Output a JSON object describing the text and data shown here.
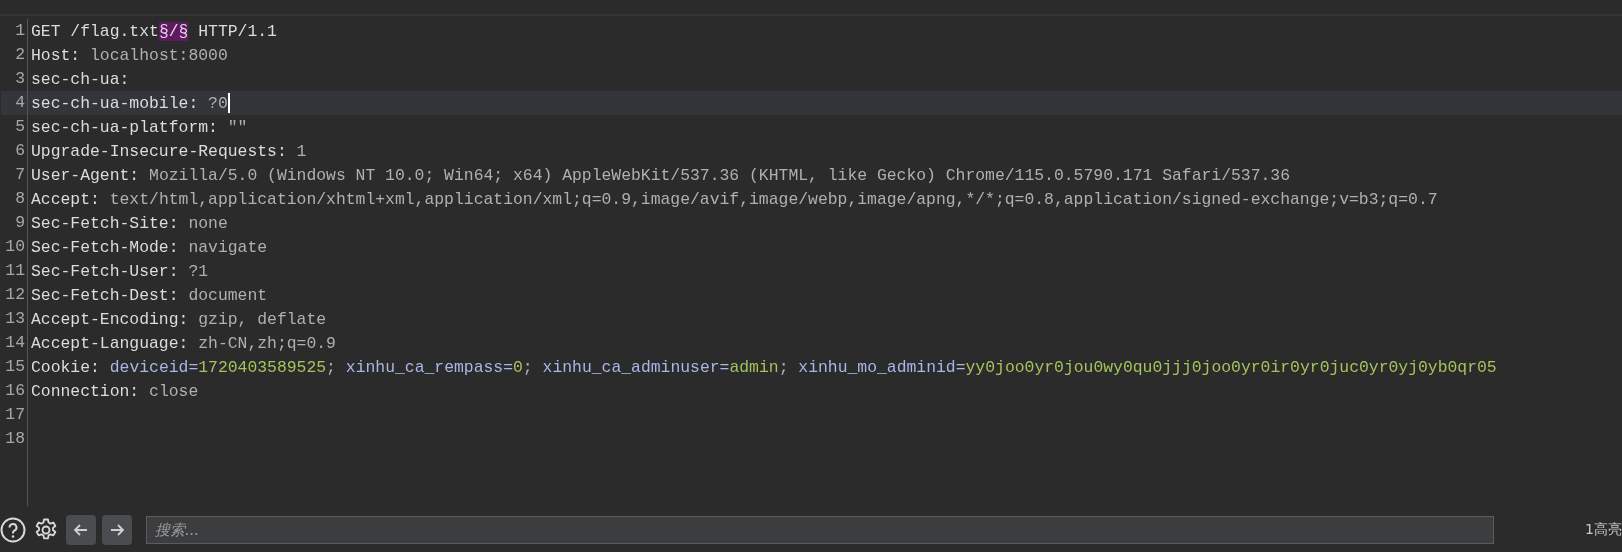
{
  "editor": {
    "lines": [
      {
        "number": "1",
        "current": false,
        "segments": [
          {
            "kind": "key",
            "text": "GET /flag.txt"
          },
          {
            "kind": "marker",
            "text": "§/§"
          },
          {
            "kind": "key",
            "text": " HTTP/1.1"
          }
        ]
      },
      {
        "number": "2",
        "current": false,
        "segments": [
          {
            "kind": "key",
            "text": "Host:"
          },
          {
            "kind": "text",
            "text": " localhost:8000"
          }
        ]
      },
      {
        "number": "3",
        "current": false,
        "segments": [
          {
            "kind": "key",
            "text": "sec-ch-ua:"
          }
        ]
      },
      {
        "number": "4",
        "current": true,
        "segments": [
          {
            "kind": "key",
            "text": "sec-ch-ua-mobile:"
          },
          {
            "kind": "text",
            "text": " ?0"
          }
        ]
      },
      {
        "number": "5",
        "current": false,
        "segments": [
          {
            "kind": "key",
            "text": "sec-ch-ua-platform:"
          },
          {
            "kind": "text",
            "text": " \"\""
          }
        ]
      },
      {
        "number": "6",
        "current": false,
        "segments": [
          {
            "kind": "key",
            "text": "Upgrade-Insecure-Requests:"
          },
          {
            "kind": "text",
            "text": " 1"
          }
        ]
      },
      {
        "number": "7",
        "current": false,
        "segments": [
          {
            "kind": "key",
            "text": "User-Agent:"
          },
          {
            "kind": "text",
            "text": " Mozilla/5.0 (Windows NT 10.0; Win64; x64) AppleWebKit/537.36 (KHTML, like Gecko) Chrome/115.0.5790.171 Safari/537.36"
          }
        ]
      },
      {
        "number": "8",
        "current": false,
        "segments": [
          {
            "kind": "key",
            "text": "Accept:"
          },
          {
            "kind": "text",
            "text": " text/html,application/xhtml+xml,application/xml;q=0.9,image/avif,image/webp,image/apng,*/*;q=0.8,application/signed-exchange;v=b3;q=0.7"
          }
        ]
      },
      {
        "number": "9",
        "current": false,
        "segments": [
          {
            "kind": "key",
            "text": "Sec-Fetch-Site:"
          },
          {
            "kind": "text",
            "text": " none"
          }
        ]
      },
      {
        "number": "10",
        "current": false,
        "segments": [
          {
            "kind": "key",
            "text": "Sec-Fetch-Mode:"
          },
          {
            "kind": "text",
            "text": " navigate"
          }
        ]
      },
      {
        "number": "11",
        "current": false,
        "segments": [
          {
            "kind": "key",
            "text": "Sec-Fetch-User:"
          },
          {
            "kind": "text",
            "text": " ?1"
          }
        ]
      },
      {
        "number": "12",
        "current": false,
        "segments": [
          {
            "kind": "key",
            "text": "Sec-Fetch-Dest:"
          },
          {
            "kind": "text",
            "text": " document"
          }
        ]
      },
      {
        "number": "13",
        "current": false,
        "segments": [
          {
            "kind": "key",
            "text": "Accept-Encoding:"
          },
          {
            "kind": "text",
            "text": " gzip, deflate"
          }
        ]
      },
      {
        "number": "14",
        "current": false,
        "segments": [
          {
            "kind": "key",
            "text": "Accept-Language:"
          },
          {
            "kind": "text",
            "text": " zh-CN,zh;q=0.9"
          }
        ]
      },
      {
        "number": "15",
        "current": false,
        "segments": [
          {
            "kind": "key",
            "text": "Cookie: "
          },
          {
            "kind": "param",
            "text": "deviceid="
          },
          {
            "kind": "value",
            "text": "1720403589525"
          },
          {
            "kind": "text",
            "text": "; "
          },
          {
            "kind": "param",
            "text": "xinhu_ca_rempass="
          },
          {
            "kind": "value",
            "text": "0"
          },
          {
            "kind": "text",
            "text": "; "
          },
          {
            "kind": "param",
            "text": "xinhu_ca_adminuser="
          },
          {
            "kind": "value",
            "text": "admin"
          },
          {
            "kind": "text",
            "text": "; "
          },
          {
            "kind": "param",
            "text": "xinhu_mo_adminid="
          },
          {
            "kind": "value",
            "text": "yy0joo0yr0jou0wy0qu0jjj0joo0yr0ir0yr0juc0yr0yj0yb0qr05"
          }
        ]
      },
      {
        "number": "16",
        "current": false,
        "segments": [
          {
            "kind": "key",
            "text": "Connection:"
          },
          {
            "kind": "text",
            "text": " close"
          }
        ]
      },
      {
        "number": "17",
        "current": false
      },
      {
        "number": "18",
        "current": false
      }
    ]
  },
  "search_bar": {
    "placeholder": "搜索...",
    "match_count": "1高亮"
  }
}
